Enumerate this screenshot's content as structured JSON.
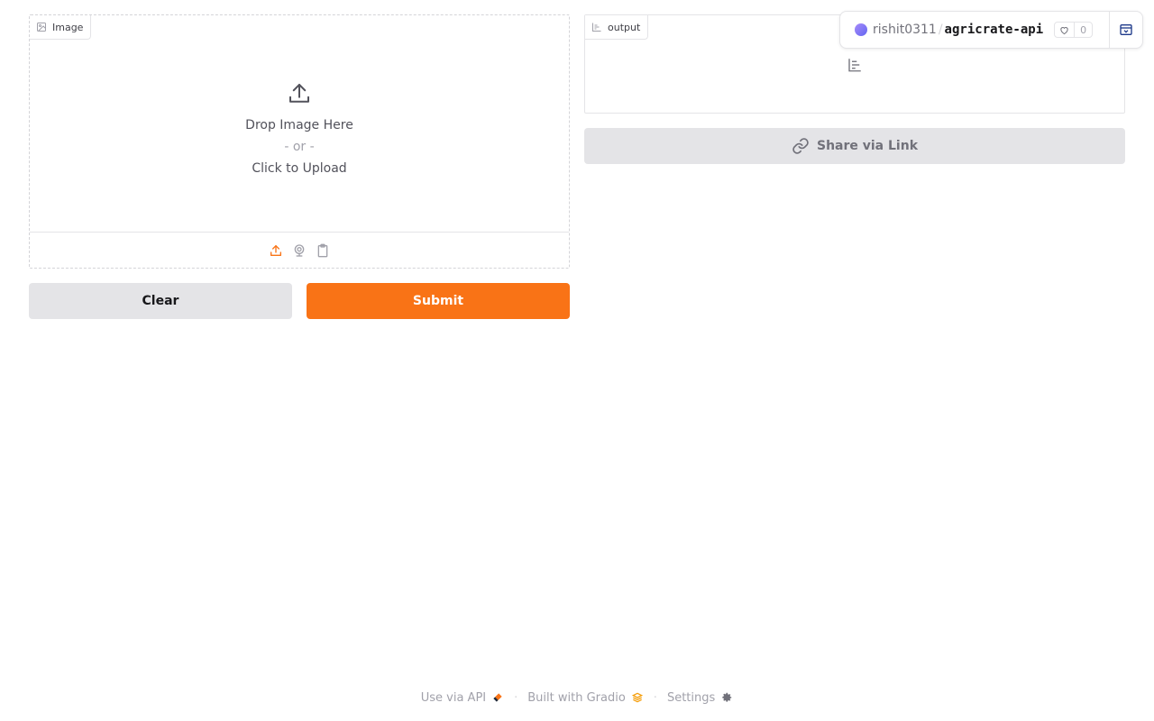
{
  "image_input": {
    "label": "Image",
    "drop_text": "Drop Image Here",
    "or_text": "- or -",
    "click_text": "Click to Upload",
    "sources": [
      "upload-icon",
      "webcam-icon",
      "clipboard-icon"
    ]
  },
  "actions": {
    "clear_label": "Clear",
    "submit_label": "Submit"
  },
  "output": {
    "label": "output",
    "share_label": "Share via Link"
  },
  "space_badge": {
    "owner": "rishit0311",
    "separator": "/",
    "name": "agricrate-api",
    "likes": "0"
  },
  "footer": {
    "api_label": "Use via API",
    "built_label": "Built with Gradio",
    "settings_label": "Settings",
    "separator": "·"
  },
  "colors": {
    "accent": "#f97316",
    "button_secondary": "#e4e4e7",
    "border": "#e4e4e7"
  }
}
